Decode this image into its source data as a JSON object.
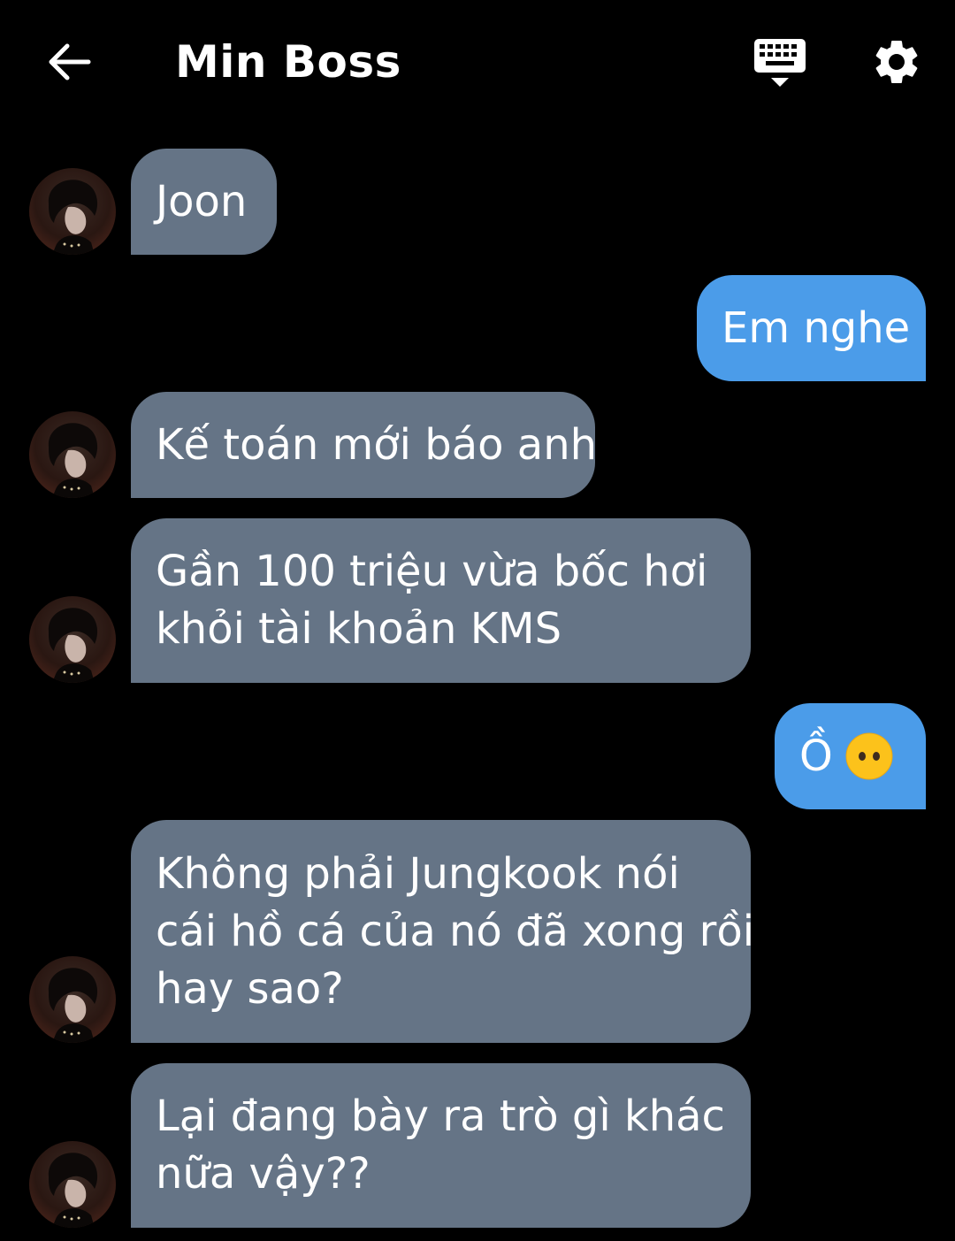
{
  "header": {
    "title": "Min Boss",
    "back_icon": "arrow-left-icon",
    "keyboard_icon": "keyboard-hide-icon",
    "settings_icon": "gear-icon"
  },
  "colors": {
    "background": "#000000",
    "incoming_bubble": "#657486",
    "outgoing_bubble": "#4b9ce9",
    "text": "#ffffff"
  },
  "messages": [
    {
      "side": "incoming",
      "text": "Joon"
    },
    {
      "side": "outgoing",
      "text": "Em nghe"
    },
    {
      "side": "incoming",
      "text": "Kế toán mới báo anh"
    },
    {
      "side": "incoming",
      "text": "Gần 100 triệu vừa bốc hơi\nkhỏi tài khoản KMS"
    },
    {
      "side": "outgoing",
      "text": "Ồ",
      "emoji": "no-mouth-face-emoji"
    },
    {
      "side": "incoming",
      "text": "Không phải Jungkook nói\ncái hồ cá của nó đã xong rồi\nhay sao?"
    },
    {
      "side": "incoming",
      "text": "Lại đang bày ra trò gì khác\nnữa vậy??"
    }
  ]
}
